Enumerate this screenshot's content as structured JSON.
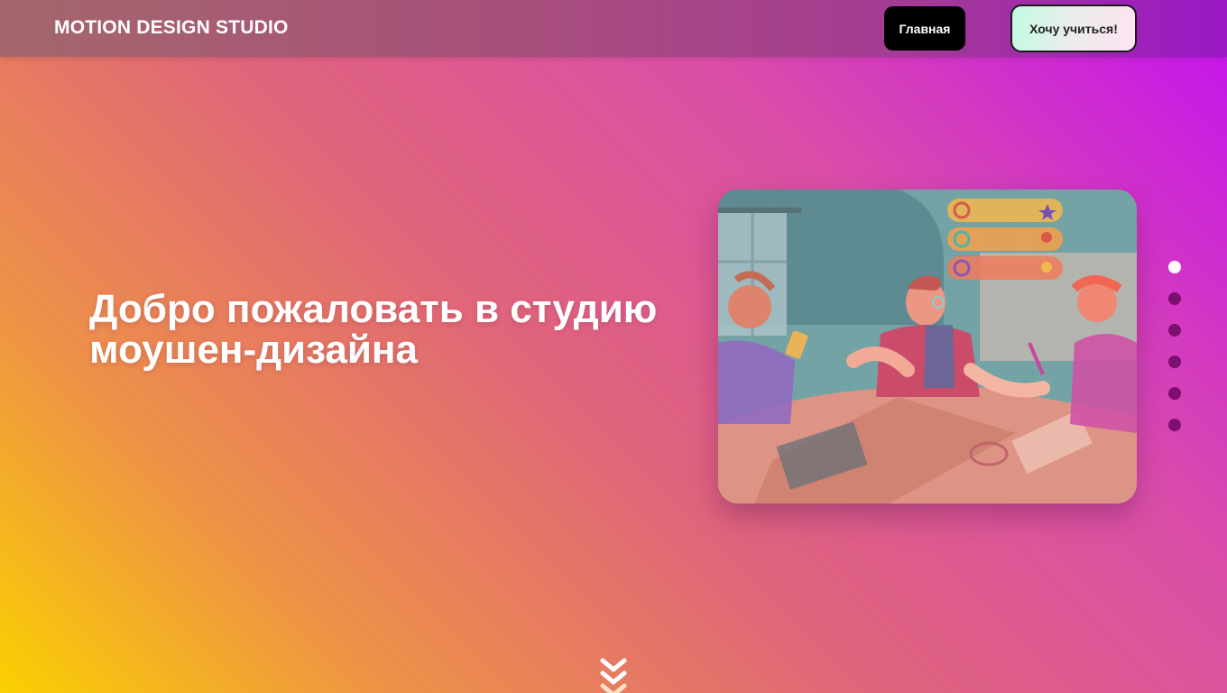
{
  "header": {
    "brand": "MOTION DESIGN STUDIO",
    "nav_home": "Главная",
    "cta_learn": "Хочу учиться!"
  },
  "hero": {
    "title": "Добро пожаловать в студию моушен-дизайна"
  },
  "slider": {
    "slide_count": 6,
    "active_index": 0,
    "image_icon": "illustration-people-with-phones"
  },
  "scroll_icon": "double-chevron-down-icon",
  "colors": {
    "nav_home_bg": "#000000",
    "dot_active": "#ffffff",
    "dot_inactive": "#7d0f70",
    "gradient_top_right": "#c412f0",
    "gradient_bottom_left": "#fbd000"
  }
}
